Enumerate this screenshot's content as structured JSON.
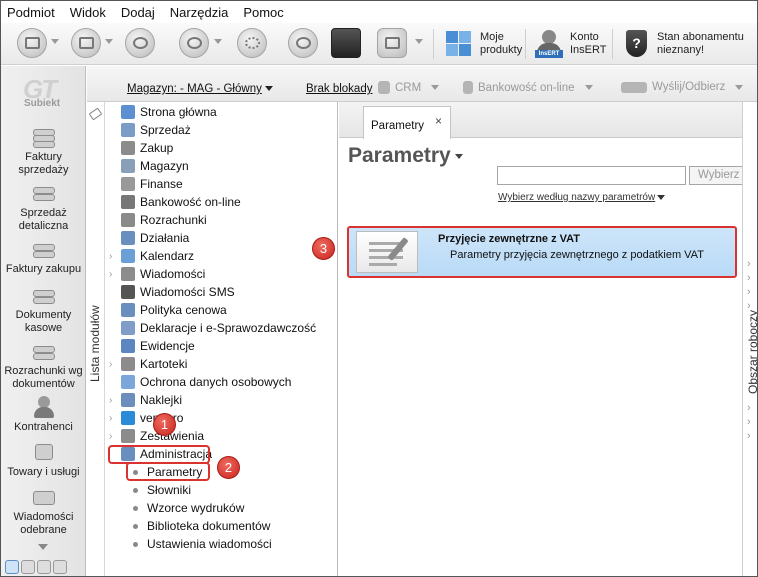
{
  "menu": [
    "Podmiot",
    "Widok",
    "Dodaj",
    "Narzędzia",
    "Pomoc"
  ],
  "toolbar": {
    "moje_produkty": "Moje\nprodukty",
    "moje_produkty_l1": "Moje",
    "moje_produkty_l2": "produkty",
    "konto_l1": "Konto",
    "konto_l2": "InsERT",
    "stan_l1": "Stan abonamentu",
    "stan_l2": "nieznany!"
  },
  "logo": {
    "brand": "GT",
    "sub": "Subiekt"
  },
  "sidebar_big": [
    {
      "l1": "Faktury",
      "l2": "sprzedaży"
    },
    {
      "l1": "Sprzedaż",
      "l2": "detaliczna"
    },
    {
      "l1": "Faktury zakupu",
      "l2": ""
    },
    {
      "l1": "Dokumenty",
      "l2": "kasowe"
    },
    {
      "l1": "Rozrachunki wg",
      "l2": "dokumentów"
    },
    {
      "l1": "Kontrahenci",
      "l2": ""
    },
    {
      "l1": "Towary i usługi",
      "l2": ""
    },
    {
      "l1": "Wiadomości",
      "l2": "odebrane"
    }
  ],
  "subbar": {
    "magazyn": "Magazyn: - MAG - Główny",
    "brak_blokady": "Brak blokady",
    "crm": "CRM",
    "bankowosc": "Bankowość on-line",
    "wyslij": "Wyślij/Odbierz"
  },
  "modules": {
    "strip_label": "Lista modułów",
    "items": [
      {
        "label": "Strona główna",
        "exp": false,
        "color": "#5b8fd0"
      },
      {
        "label": "Sprzedaż",
        "exp": false,
        "color": "#7a9cc6"
      },
      {
        "label": "Zakup",
        "exp": false,
        "color": "#8c8c8c"
      },
      {
        "label": "Magazyn",
        "exp": false,
        "color": "#8aa0b8"
      },
      {
        "label": "Finanse",
        "exp": false,
        "color": "#999999"
      },
      {
        "label": "Bankowość on-line",
        "exp": false,
        "color": "#777777"
      },
      {
        "label": "Rozrachunki",
        "exp": false,
        "color": "#8a8a8a"
      },
      {
        "label": "Działania",
        "exp": false,
        "color": "#6a8fbf"
      },
      {
        "label": "Kalendarz",
        "exp": true,
        "color": "#6aa0d6"
      },
      {
        "label": "Wiadomości",
        "exp": true,
        "color": "#8c8c8c"
      },
      {
        "label": "Wiadomości SMS",
        "exp": false,
        "color": "#555555"
      },
      {
        "label": "Polityka cenowa",
        "exp": false,
        "color": "#6a8fbf"
      },
      {
        "label": "Deklaracje i e-Sprawozdawczość",
        "exp": false,
        "color": "#7e9ec9"
      },
      {
        "label": "Ewidencje",
        "exp": false,
        "color": "#5c86c0"
      },
      {
        "label": "Kartoteki",
        "exp": true,
        "color": "#8c8c8c"
      },
      {
        "label": "Ochrona danych osobowych",
        "exp": false,
        "color": "#7aa6da"
      },
      {
        "label": "Naklejki",
        "exp": true,
        "color": "#6a8fbf"
      },
      {
        "label": "vendero",
        "exp": true,
        "color": "#2a8bd8"
      },
      {
        "label": "Zestawienia",
        "exp": true,
        "color": "#8c8c8c"
      },
      {
        "label": "Administracja",
        "exp": false,
        "color": "#6a8fbf"
      }
    ],
    "sub_items": [
      "Parametry",
      "Słowniki",
      "Wzorce wydruków",
      "Biblioteka dokumentów",
      "Ustawienia wiadomości"
    ]
  },
  "badges": [
    "1",
    "2",
    "3"
  ],
  "main": {
    "tab_label": "Parametry",
    "tab_close": "×",
    "page_title": "Parametry",
    "search_value": "",
    "search_button": "Wybierz",
    "filter_label": "Wybierz według nazwy parametrów",
    "card_title": "Przyjęcie zewnętrzne z VAT",
    "card_desc": "Parametry przyjęcia zewnętrznego z podatkiem VAT"
  },
  "right_strip_label": "Obszar roboczy",
  "colors": {
    "highlight": "#d9322f",
    "card_bg": "#c3def8"
  }
}
